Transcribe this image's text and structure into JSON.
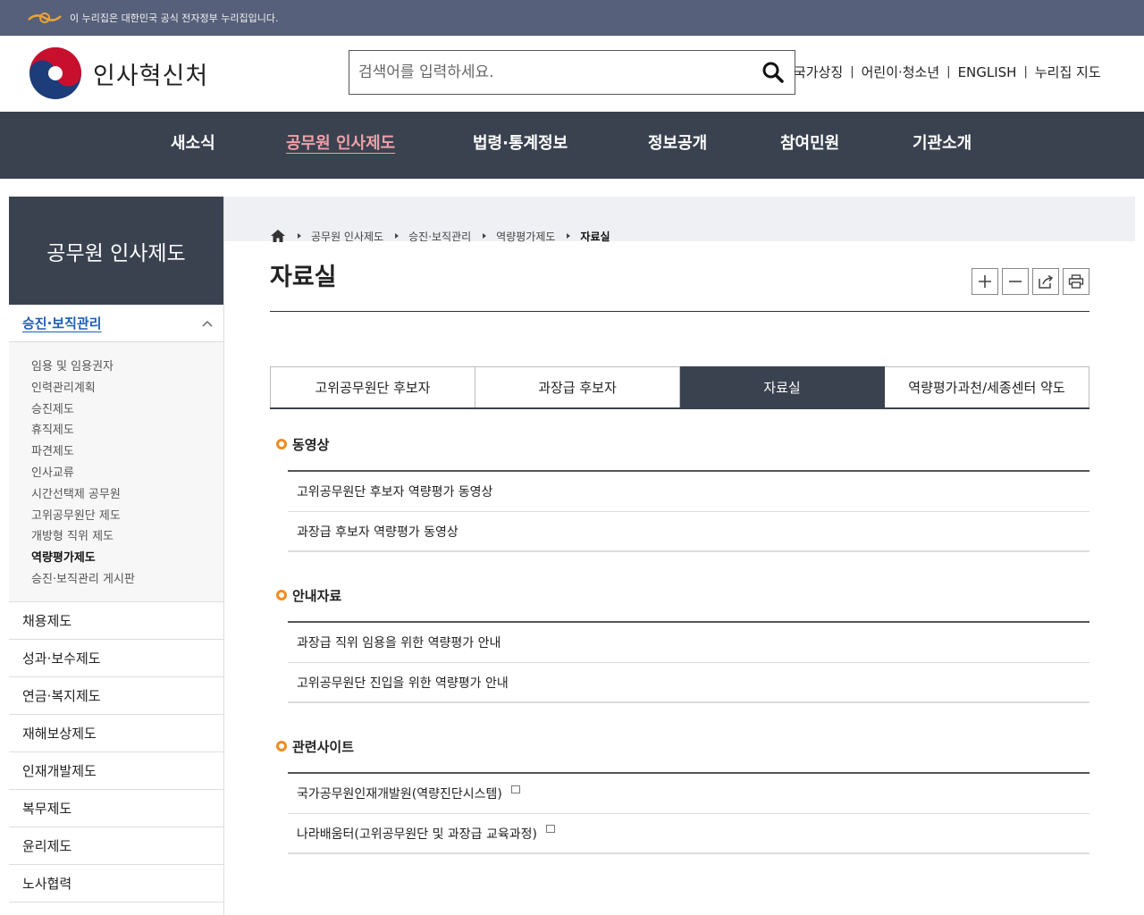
{
  "gov_banner": {
    "text": "이 누리집은 대한민국 공식 전자정부 누리집입니다."
  },
  "header": {
    "brand_name": "인사혁신처",
    "search": {
      "placeholder": "검색어를 입력하세요.",
      "value": ""
    },
    "util_links": [
      "국가상징",
      "어린이·청소년",
      "ENGLISH",
      "누리집 지도"
    ]
  },
  "gnb": {
    "items": [
      "새소식",
      "공무원 인사제도",
      "법령·통계정보",
      "정보공개",
      "참여민원",
      "기관소개"
    ],
    "active": "공무원 인사제도"
  },
  "sidebar": {
    "title": "공무원 인사제도",
    "current_section": "승진·보직관리",
    "sub_items": [
      "임용 및 임용권자",
      "인력관리계획",
      "승진제도",
      "휴직제도",
      "파견제도",
      "인사교류",
      "시간선택제 공무원",
      "고위공무원단 제도",
      "개방형 직위 제도",
      "역량평가제도",
      "승진·보직관리 게시판"
    ],
    "sub_active": "역량평가제도",
    "sections": [
      "채용제도",
      "성과·보수제도",
      "연금·복지제도",
      "재해보상제도",
      "인재개발제도",
      "복무제도",
      "윤리제도",
      "노사협력"
    ]
  },
  "breadcrumb": [
    "공무원 인사제도",
    "승진·보직관리",
    "역량평가제도",
    "자료실"
  ],
  "page_title": "자료실",
  "tabs": {
    "items": [
      "고위공무원단 후보자",
      "과장급 후보자",
      "자료실",
      "역량평가과천/세종센터 약도"
    ],
    "active": "자료실"
  },
  "sections": [
    {
      "title": "동영상",
      "links": [
        "고위공무원단 후보자 역량평가 동영상",
        "과장급 후보자 역량평가 동영상"
      ]
    },
    {
      "title": "안내자료",
      "links": [
        "과장급 직위 임용을 위한 역량평가 안내",
        "고위공무원단 진입을 위한 역량평가 안내"
      ]
    },
    {
      "title": "관련사이트",
      "links": [
        "국가공무원인재개발원(역량진단시스템)",
        "나라배움터(고위공무원단 및 과장급 교육과정)"
      ]
    }
  ],
  "colors": {
    "nav_bg": "#3a4250",
    "banner_bg": "#56607a",
    "accent_orange": "#f08c1e",
    "active_nav_text": "#f0a0a8",
    "sidebar_active": "#1a5fb4"
  }
}
